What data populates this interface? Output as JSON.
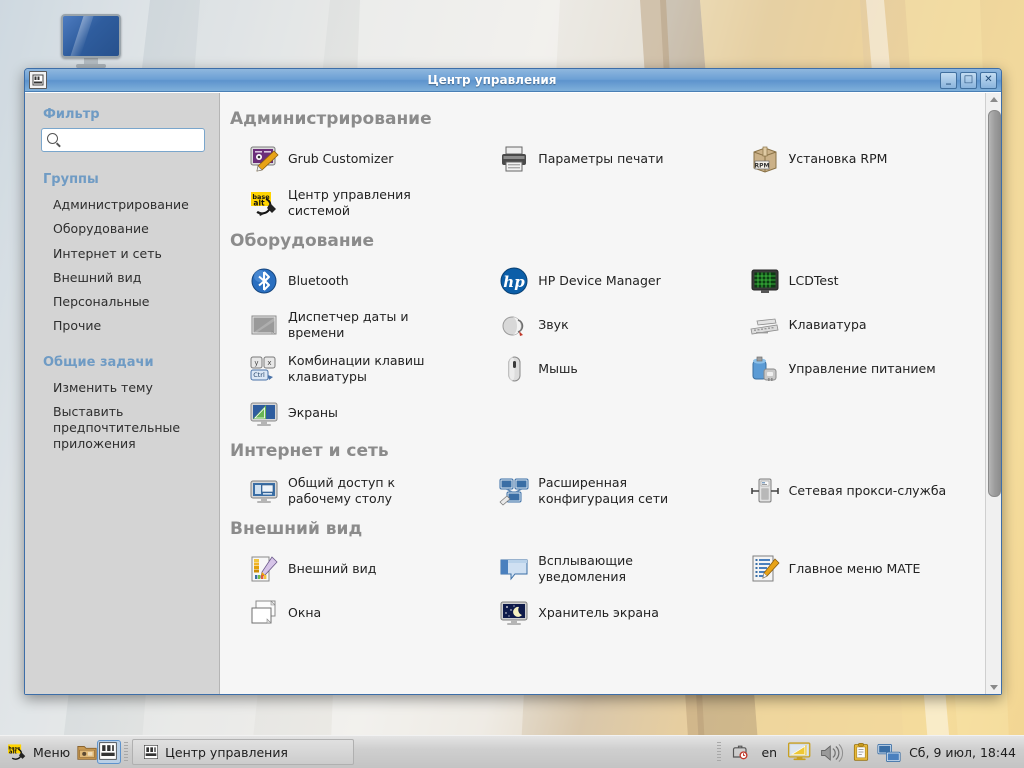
{
  "desktop": {
    "icon_name": "computer-desktop-icon"
  },
  "window": {
    "title": "Центр управления",
    "window_icon": "control-center-icon",
    "buttons": {
      "minimize": "_",
      "maximize": "□",
      "close": "✕"
    }
  },
  "sidebar": {
    "filter_heading": "Фильтр",
    "filter_placeholder": "",
    "filter_value": "",
    "groups_heading": "Группы",
    "groups": [
      {
        "label": "Администрирование"
      },
      {
        "label": "Оборудование"
      },
      {
        "label": "Интернет и сеть"
      },
      {
        "label": "Внешний вид"
      },
      {
        "label": "Персональные"
      },
      {
        "label": "Прочие"
      }
    ],
    "common_heading": "Общие задачи",
    "common_tasks": [
      {
        "label": "Изменить тему"
      },
      {
        "label": "Выставить предпочтительные приложения"
      }
    ]
  },
  "content": {
    "sections": [
      {
        "title": "Администрирование",
        "items": [
          {
            "label": "Grub Customizer",
            "icon": "grub-customizer-icon"
          },
          {
            "label": "Параметры печати",
            "icon": "printer-icon"
          },
          {
            "label": "Установка RPM",
            "icon": "rpm-package-icon"
          },
          {
            "label": "Центр управления системой",
            "icon": "basealt-icon"
          }
        ]
      },
      {
        "title": "Оборудование",
        "items": [
          {
            "label": "Bluetooth",
            "icon": "bluetooth-icon"
          },
          {
            "label": "HP Device Manager",
            "icon": "hp-logo-icon"
          },
          {
            "label": "LCDTest",
            "icon": "lcd-test-icon"
          },
          {
            "label": "Диспетчер даты и времени",
            "icon": "datetime-icon"
          },
          {
            "label": "Звук",
            "icon": "sound-icon"
          },
          {
            "label": "Клавиатура",
            "icon": "keyboard-icon"
          },
          {
            "label": "Комбинации клавиш клавиатуры",
            "icon": "keyboard-shortcuts-icon"
          },
          {
            "label": "Мышь",
            "icon": "mouse-icon"
          },
          {
            "label": "Управление питанием",
            "icon": "power-management-icon"
          },
          {
            "label": "Экраны",
            "icon": "displays-icon"
          }
        ]
      },
      {
        "title": "Интернет и сеть",
        "items": [
          {
            "label": "Общий доступ к рабочему столу",
            "icon": "desktop-sharing-icon"
          },
          {
            "label": "Расширенная конфигурация сети",
            "icon": "network-config-icon"
          },
          {
            "label": "Сетевая прокси-служба",
            "icon": "network-proxy-icon"
          }
        ]
      },
      {
        "title": "Внешний вид",
        "items": [
          {
            "label": "Внешний вид",
            "icon": "appearance-icon"
          },
          {
            "label": "Всплывающие уведомления",
            "icon": "notifications-icon"
          },
          {
            "label": "Главное меню MATE",
            "icon": "main-menu-icon"
          },
          {
            "label": "Окна",
            "icon": "windows-icon"
          },
          {
            "label": "Хранитель экрана",
            "icon": "screensaver-icon"
          }
        ]
      }
    ]
  },
  "taskbar": {
    "menu_label": "Меню",
    "launchers": [
      {
        "name": "file-manager-icon"
      },
      {
        "name": "control-center-icon"
      }
    ],
    "tasks": [
      {
        "label": "Центр управления",
        "icon": "control-center-icon"
      }
    ],
    "tray": {
      "icons": [
        "clock-applet-icon",
        "display-icon",
        "volume-icon",
        "clipboard-icon",
        "network-icon"
      ],
      "keyboard_layout": "en",
      "clock": "Сб,  9 июл, 18:44"
    }
  },
  "colors": {
    "title_bar": "#6b9fd4",
    "heading_blue": "#6f9bc4",
    "section_gray": "#8b8b8b",
    "sidebar_bg": "#d4d4d4",
    "content_bg": "#f6f6f6"
  }
}
